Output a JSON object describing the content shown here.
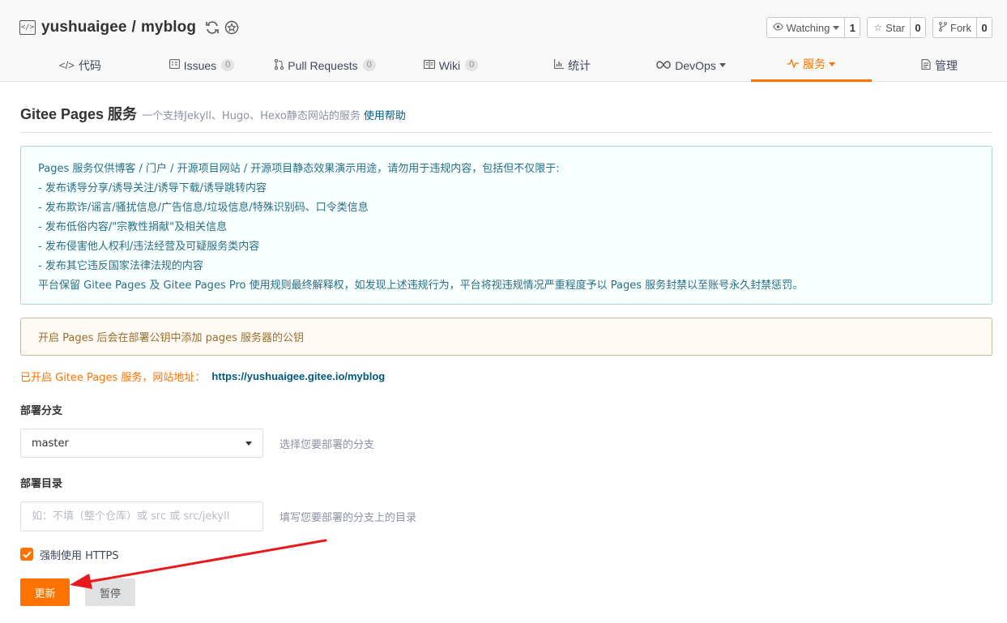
{
  "repo": {
    "owner": "yushuaigee",
    "separator": "/",
    "name": "myblog"
  },
  "actions": {
    "watch": {
      "label": "Watching",
      "count": "1"
    },
    "star": {
      "label": "Star",
      "count": "0"
    },
    "fork": {
      "label": "Fork",
      "count": "0"
    }
  },
  "tabs": [
    {
      "label": "代码",
      "icon": "code-icon"
    },
    {
      "label": "Issues",
      "icon": "issues-icon",
      "badge": "0"
    },
    {
      "label": "Pull Requests",
      "icon": "pull-request-icon",
      "badge": "0"
    },
    {
      "label": "Wiki",
      "icon": "wiki-icon",
      "badge": "0"
    },
    {
      "label": "统计",
      "icon": "chart-icon"
    },
    {
      "label": "DevOps",
      "icon": "infinity-icon"
    },
    {
      "label": "服务",
      "icon": "pulse-icon",
      "active": true
    },
    {
      "label": "管理",
      "icon": "settings-doc-icon"
    }
  ],
  "page": {
    "title": "Gitee Pages 服务",
    "subtitle": "一个支持Jekyll、Hugo、Hexo静态网站的服务",
    "help_link": "使用帮助"
  },
  "notice": {
    "lines": [
      "Pages 服务仅供博客 / 门户 / 开源项目网站 / 开源项目静态效果演示用途，请勿用于违规内容，包括但不仅限于:",
      "- 发布诱导分享/诱导关注/诱导下载/诱导跳转内容",
      "- 发布欺诈/谣言/骚扰信息/广告信息/垃圾信息/特殊识别码、口令类信息",
      "- 发布低俗内容/\"宗教性捐献\"及相关信息",
      "- 发布侵害他人权利/违法经营及可疑服务类内容",
      "- 发布其它违反国家法律法规的内容",
      "平台保留 Gitee Pages 及 Gitee Pages Pro 使用规则最终解释权，如发现上述违规行为，平台将视违规情况严重程度予以 Pages 服务封禁以至账号永久封禁惩罚。"
    ]
  },
  "warning": "开启 Pages 后会在部署公钥中添加 pages 服务器的公钥",
  "site": {
    "label": "已开启 Gitee Pages 服务，网站地址：",
    "url": "https://yushuaigee.gitee.io/myblog"
  },
  "form": {
    "branch_label": "部署分支",
    "branch_value": "master",
    "branch_hint": "选择您要部署的分支",
    "dir_label": "部署目录",
    "dir_placeholder": "如：不填（整个仓库）或 src 或 src/jekyll",
    "dir_value": "",
    "dir_hint": "填写您要部署的分支上的目录",
    "https_label": "强制使用 HTTPS",
    "https_checked": true
  },
  "buttons": {
    "update": "更新",
    "pause": "暂停"
  },
  "colors": {
    "accent": "#fe7300",
    "link": "#005980",
    "notice_text": "#276f86",
    "warning_text": "#9a6e2f",
    "annotation_arrow": "#e8191d"
  }
}
